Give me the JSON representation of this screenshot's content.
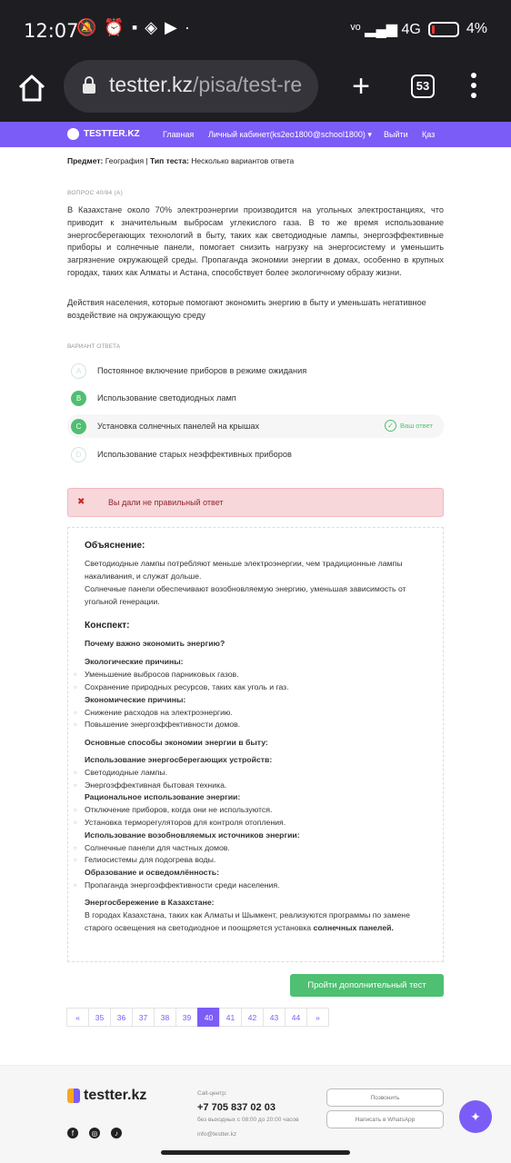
{
  "status_bar": {
    "time": "12:07",
    "battery_percent": "4%",
    "network": "4G"
  },
  "browser": {
    "url_host": "testter.kz",
    "url_path": "/pisa/test-re",
    "tab_count": "53"
  },
  "site_nav": {
    "logo": "TESTTER.KZ",
    "items": [
      "Главная",
      "Личный кабинет(ks2eo1800@school1800) ▾",
      "Выйти",
      "Қаз"
    ]
  },
  "meta": {
    "subject_label": "Предмет:",
    "subject_value": "География",
    "type_label": "Тип теста:",
    "type_value": "Несколько вариантов ответа"
  },
  "question": {
    "number": "ВОПРОС 40/84 (A)",
    "text": "В Казахстане около 70% электроэнергии производится на угольных электростанциях, что приводит к значительным выбросам углекислого газа. В то же время использование энергосберегающих технологий в быту, таких как светодиодные лампы, энергоэффективные приборы и солнечные панели, помогает снизить нагрузку на энергосистему и уменьшить загрязнение окружающей среды. Пропаганда экономии энергии в домах, особенно в крупных городах, таких как Алматы и Астана, способствует более экологичному образу жизни.",
    "prompt": "Действия населения, которые помогают экономить энергию в быту и уменьшать негативное воздействие на окружающую среду"
  },
  "answers": {
    "label": "ВАРИАНТ ОТВЕТА",
    "your_answer_label": "Ваш ответ",
    "options": [
      {
        "letter": "A",
        "text": "Постоянное включение приборов в режиме ожидания"
      },
      {
        "letter": "B",
        "text": "Использование светодиодных ламп"
      },
      {
        "letter": "C",
        "text": "Установка солнечных панелей на крышах"
      },
      {
        "letter": "D",
        "text": "Использование старых неэффективных приборов"
      }
    ]
  },
  "result": {
    "text": "Вы дали не правильный ответ"
  },
  "explanation": {
    "title": "Объяснение:",
    "p1": "Светодиодные лампы потребляют меньше электроэнергии, чем традиционные лампы накаливания, и служат дольше.",
    "p2": "Солнечные панели обеспечивают возобновляемую энергию, уменьшая зависимость от угольной генерации.",
    "summary_title": "Конспект:",
    "why_title": "Почему важно экономить энергию?",
    "eco_title": "Экологические причины:",
    "eco": [
      "Уменьшение выбросов парниковых газов.",
      "Сохранение природных ресурсов, таких как уголь и газ."
    ],
    "econ_title": "Экономические причины:",
    "econ": [
      "Снижение расходов на электроэнергию.",
      "Повышение энергоэффективности домов."
    ],
    "ways_title": "Основные способы экономии энергии в быту:",
    "devices_title": "Использование энергосберегающих устройств:",
    "devices": [
      "Светодиодные лампы.",
      "Энергоэффективная бытовая техника."
    ],
    "rational_title": "Рациональное использование энергии:",
    "rational": [
      "Отключение приборов, когда они не используются.",
      "Установка терморегуляторов для контроля отопления."
    ],
    "renew_title": "Использование возобновляемых источников энергии:",
    "renew": [
      "Солнечные панели для частных домов.",
      "Гелиосистемы для подогрева воды."
    ],
    "edu_title": "Образование и осведомлённость:",
    "edu": [
      "Пропаганда энергоэффективности среди населения."
    ],
    "kz_title": "Энергосбережение в Казахстане:",
    "kz_text": "В городах Казахстана, таких как Алматы и Шымкент, реализуются программы по замене старого освещения на светодиодное и поощряется установка",
    "kz_bold": "солнечных панелей."
  },
  "more_button": "Пройти дополнительный тест",
  "pager": [
    "«",
    "35",
    "36",
    "37",
    "38",
    "39",
    "40",
    "41",
    "42",
    "43",
    "44",
    "»"
  ],
  "footer": {
    "logo": "testter.kz",
    "call_label": "Call-центр:",
    "phone": "+7 705 837 02 03",
    "hours": "без выходных с 08:00 до 20:00 часов",
    "email": "info@testter.kz",
    "btn_call": "Позвонить",
    "btn_whatsapp": "Написать в WhatsApp"
  }
}
